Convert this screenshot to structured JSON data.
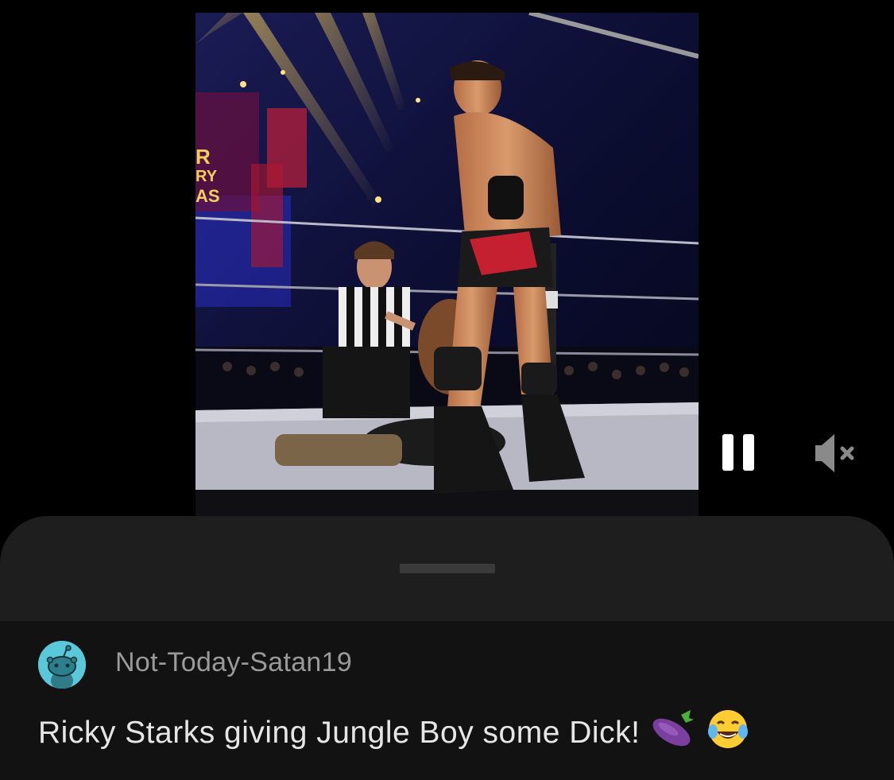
{
  "post": {
    "video": {
      "description_icon": "video-player",
      "playing": true,
      "muted": true
    },
    "controls": {
      "pause_icon": "pause-icon",
      "mute_icon": "speaker-muted-icon"
    }
  },
  "comment": {
    "username": "Not-Today-Satan19",
    "avatar_icon": "snoo-avatar-icon",
    "text": "Ricky Starks giving Jungle Boy some Dick!",
    "emojis": [
      "eggplant-emoji",
      "tears-of-joy-emoji"
    ]
  },
  "colors": {
    "background": "#000000",
    "sheet": "#1e1e1e",
    "comment_bg": "#121212",
    "avatar": "#5ac8d8",
    "username": "#9a9a9a",
    "comment_text": "#e6e6e6"
  }
}
